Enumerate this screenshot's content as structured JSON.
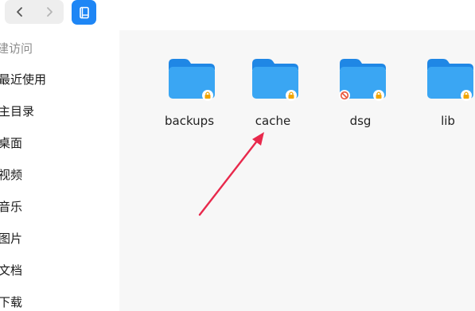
{
  "toolbar": {
    "back_icon": "chevron-left-icon",
    "forward_icon": "chevron-right-icon",
    "view_icon": "book-icon",
    "accent_color": "#1e86f5"
  },
  "sidebar": {
    "header": "建访问",
    "items": [
      {
        "label": "最近使用"
      },
      {
        "label": "主目录"
      },
      {
        "label": "桌面"
      },
      {
        "label": "视频"
      },
      {
        "label": "音乐"
      },
      {
        "label": "图片"
      },
      {
        "label": "文档"
      },
      {
        "label": "下载"
      }
    ]
  },
  "folders": [
    {
      "name": "backups",
      "badges": [
        "lock-icon"
      ]
    },
    {
      "name": "cache",
      "badges": [
        "lock-icon"
      ]
    },
    {
      "name": "dsg",
      "badges": [
        "no-access-icon",
        "lock-icon"
      ]
    },
    {
      "name": "lib",
      "badges": [
        "lock-icon"
      ]
    }
  ],
  "annotation": {
    "arrow_color": "#e8294c",
    "points_to": "cache"
  }
}
